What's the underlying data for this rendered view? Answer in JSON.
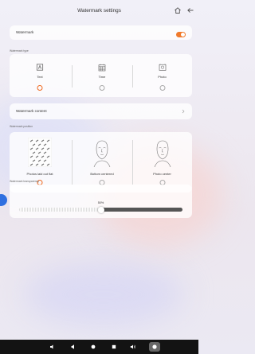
{
  "header": {
    "title": "Watermark settings",
    "home_icon": "home-icon",
    "back_icon": "back-arrow-icon"
  },
  "watermark": {
    "label": "Watermark",
    "enabled": true,
    "accent": "#f07a2c"
  },
  "watermark_type": {
    "section_label": "Watermark type",
    "options": [
      {
        "label": "Text",
        "icon": "text-box-icon",
        "selected": true
      },
      {
        "label": "Time",
        "icon": "calendar-grid-icon",
        "selected": false
      },
      {
        "label": "Photo",
        "icon": "photo-frame-icon",
        "selected": false
      }
    ]
  },
  "watermark_content": {
    "label": "Watermark content",
    "icon": "chevron-right-icon"
  },
  "watermark_position": {
    "section_label": "Watermark position",
    "options": [
      {
        "label": "Photos laid out flat",
        "selected": true
      },
      {
        "label": "Bottom centered",
        "selected": false
      },
      {
        "label": "Photo center",
        "selected": false
      }
    ]
  },
  "watermark_transparency": {
    "section_label": "Watermark transparency",
    "value_label": "50%",
    "value": 0.5
  },
  "navbar": {
    "icons": [
      "volume-down-icon",
      "back-triangle-icon",
      "home-circle-icon",
      "recents-square-icon",
      "volume-up-icon",
      "app-active-icon"
    ]
  }
}
